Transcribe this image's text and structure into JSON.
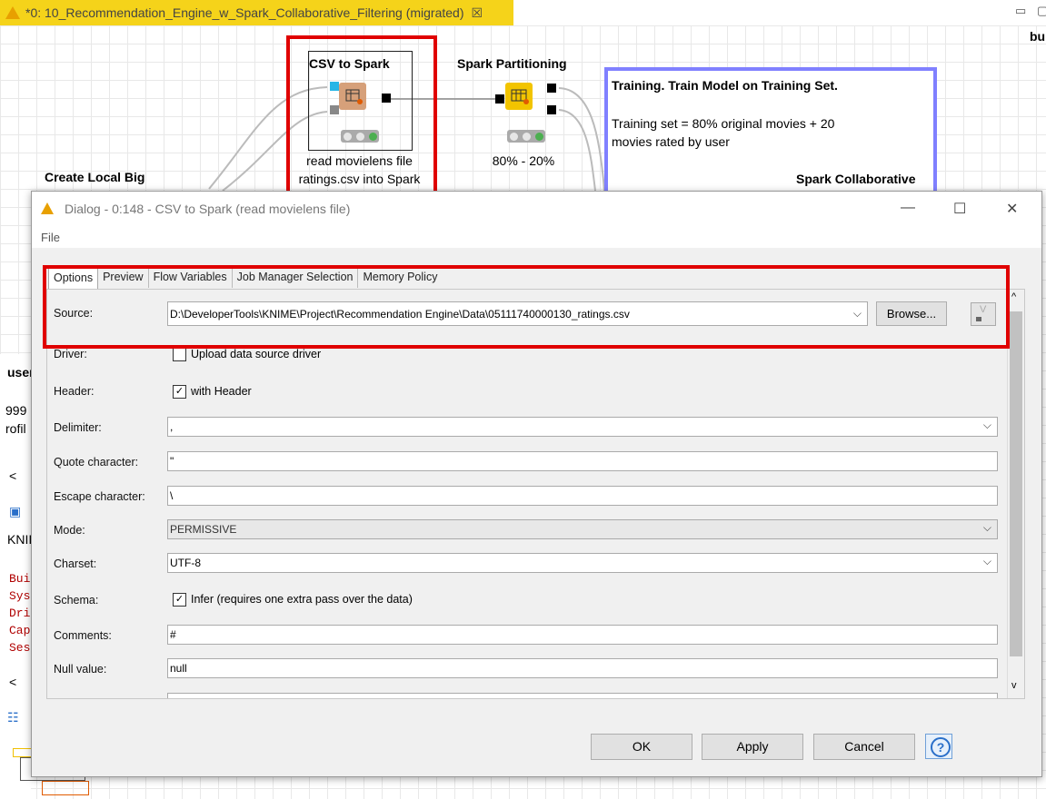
{
  "editor": {
    "tab_title": "*0: 10_Recommendation_Engine_w_Spark_Collaborative_Filtering (migrated)",
    "close_glyph": "☒",
    "right_snippet": "bu"
  },
  "workflow": {
    "nodes": [
      {
        "title": "CSV to Spark",
        "sub1": "read movielens file",
        "sub2": "ratings.csv into Spark"
      },
      {
        "title": "Spark Partitioning",
        "sub1": "80% - 20%"
      }
    ],
    "annotation": {
      "title": "Training. Train Model on Training Set.",
      "line1": "Training set = 80% original movies +  20",
      "line2": "movies rated by user",
      "footer": "Spark Collaborative"
    },
    "left_label": "Create Local Big",
    "left_snippets": [
      "user",
      "999",
      "rofil",
      "KNII",
      "Bui",
      "Sys",
      "Dri",
      "Cap",
      "Ses"
    ]
  },
  "dialog": {
    "title": "Dialog - 0:148 - CSV to Spark (read movielens file)",
    "menu": {
      "file": "File"
    },
    "tabs": [
      "Options",
      "Preview",
      "Flow Variables",
      "Job Manager Selection",
      "Memory Policy"
    ],
    "fields": {
      "source": {
        "label": "Source:",
        "value": "D:\\DeveloperTools\\KNIME\\Project\\Recommendation Engine\\Data\\05111740000130_ratings.csv"
      },
      "browse": "Browse...",
      "driver": {
        "label": "Driver:",
        "checkbox_label": "Upload data source driver",
        "checked": false
      },
      "header": {
        "label": "Header:",
        "checkbox_label": "with Header",
        "checked": true
      },
      "delimiter": {
        "label": "Delimiter:",
        "value": ","
      },
      "quote": {
        "label": "Quote character:",
        "value": "\""
      },
      "escape": {
        "label": "Escape character:",
        "value": "\\"
      },
      "mode": {
        "label": "Mode:",
        "value": "PERMISSIVE"
      },
      "charset": {
        "label": "Charset:",
        "value": "UTF-8"
      },
      "schema": {
        "label": "Schema:",
        "checkbox_label": "Infer (requires one extra pass over the data)",
        "checked": true
      },
      "comments": {
        "label": "Comments:",
        "value": "#"
      },
      "null_value": {
        "label": "Null value:",
        "value": "null"
      }
    },
    "buttons": {
      "ok": "OK",
      "apply": "Apply",
      "cancel": "Cancel",
      "help": "?"
    }
  },
  "colors": {
    "highlight": "#e00000",
    "annotation_border": "#8080ff",
    "tab_bar": "#f5d31a"
  }
}
